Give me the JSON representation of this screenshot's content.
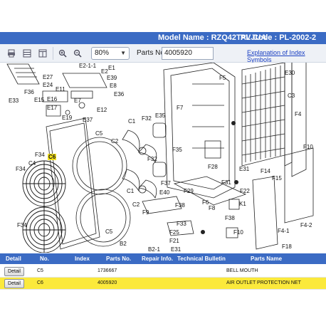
{
  "header": {
    "model_name": "Model Name : RZQ42TAVJUA",
    "pl_code": "PL Code : PL-2002-2"
  },
  "toolbar": {
    "zoom_value": "80%",
    "parts_no_label": "Parts No.",
    "parts_no_value": "4005920",
    "explanation_link": "Explanation of Index Symbols"
  },
  "diagram": {
    "labels": [
      "E2-1-1",
      "E2",
      "E1",
      "E39",
      "E8",
      "E36",
      "E27",
      "E11",
      "E24",
      "F36",
      "E33",
      "E15",
      "E17",
      "E16",
      "E7",
      "E12",
      "E19",
      "E37",
      "E35",
      "C1",
      "F32",
      "C5",
      "F34",
      "C6",
      "C4",
      "F34",
      "F34",
      "C2",
      "C1",
      "F7",
      "F5",
      "E30",
      "C3",
      "F4",
      "F10",
      "F35",
      "F28",
      "F32",
      "E40",
      "F29",
      "F31",
      "F6",
      "F37",
      "F38",
      "F22",
      "K1",
      "F14",
      "F15",
      "E31",
      "F8",
      "F9",
      "C2",
      "C5",
      "F33",
      "F25",
      "F21",
      "E31",
      "F10",
      "F38",
      "F4-1",
      "F4-2",
      "F18",
      "B2",
      "B2-1"
    ],
    "highlighted_label": "C6"
  },
  "table": {
    "headers": [
      "Detail",
      "No.",
      "Index",
      "Parts No.",
      "Repair Info.",
      "Technical Bulletin",
      "Parts Name"
    ],
    "rows": [
      {
        "detail": "Detail",
        "no": "C5",
        "index": "",
        "parts_no": "1736667",
        "repair": "",
        "bulletin": "",
        "name": "BELL MOUTH",
        "selected": false
      },
      {
        "detail": "Detail",
        "no": "C6",
        "index": "",
        "parts_no": "4005920",
        "repair": "",
        "bulletin": "",
        "name": "AIR OUTLET PROTECTION NET",
        "selected": true
      }
    ]
  },
  "colors": {
    "header_blue": "#3b6bc4",
    "highlight_yellow": "#fbe93b",
    "link_blue": "#1a3fc2"
  },
  "icons": [
    "print-icon",
    "list-icon",
    "panel-icon",
    "zoom-in-icon",
    "zoom-out-icon"
  ]
}
